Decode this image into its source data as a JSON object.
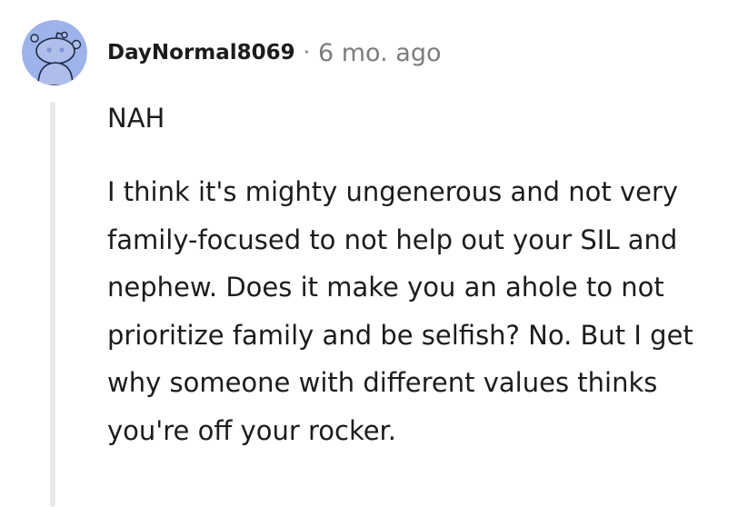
{
  "comment": {
    "username": "DayNormal8069",
    "separator": "·",
    "age": "6 mo. ago",
    "paragraphs": [
      "NAH",
      "I think it's mighty ungenerous and not very family-focused to not help out your SIL and nephew. Does it make you an ahole to not prioritize family and be selfish? No. But I get why someone with different values thinks you're off your rocker."
    ]
  },
  "avatar_icon": "snoo-avatar-icon",
  "colors": {
    "avatar_bg": "#9db3ea",
    "text": "#1c1c1c",
    "meta_gray": "#7c7c7c",
    "thread_line": "#e6e8ea"
  }
}
